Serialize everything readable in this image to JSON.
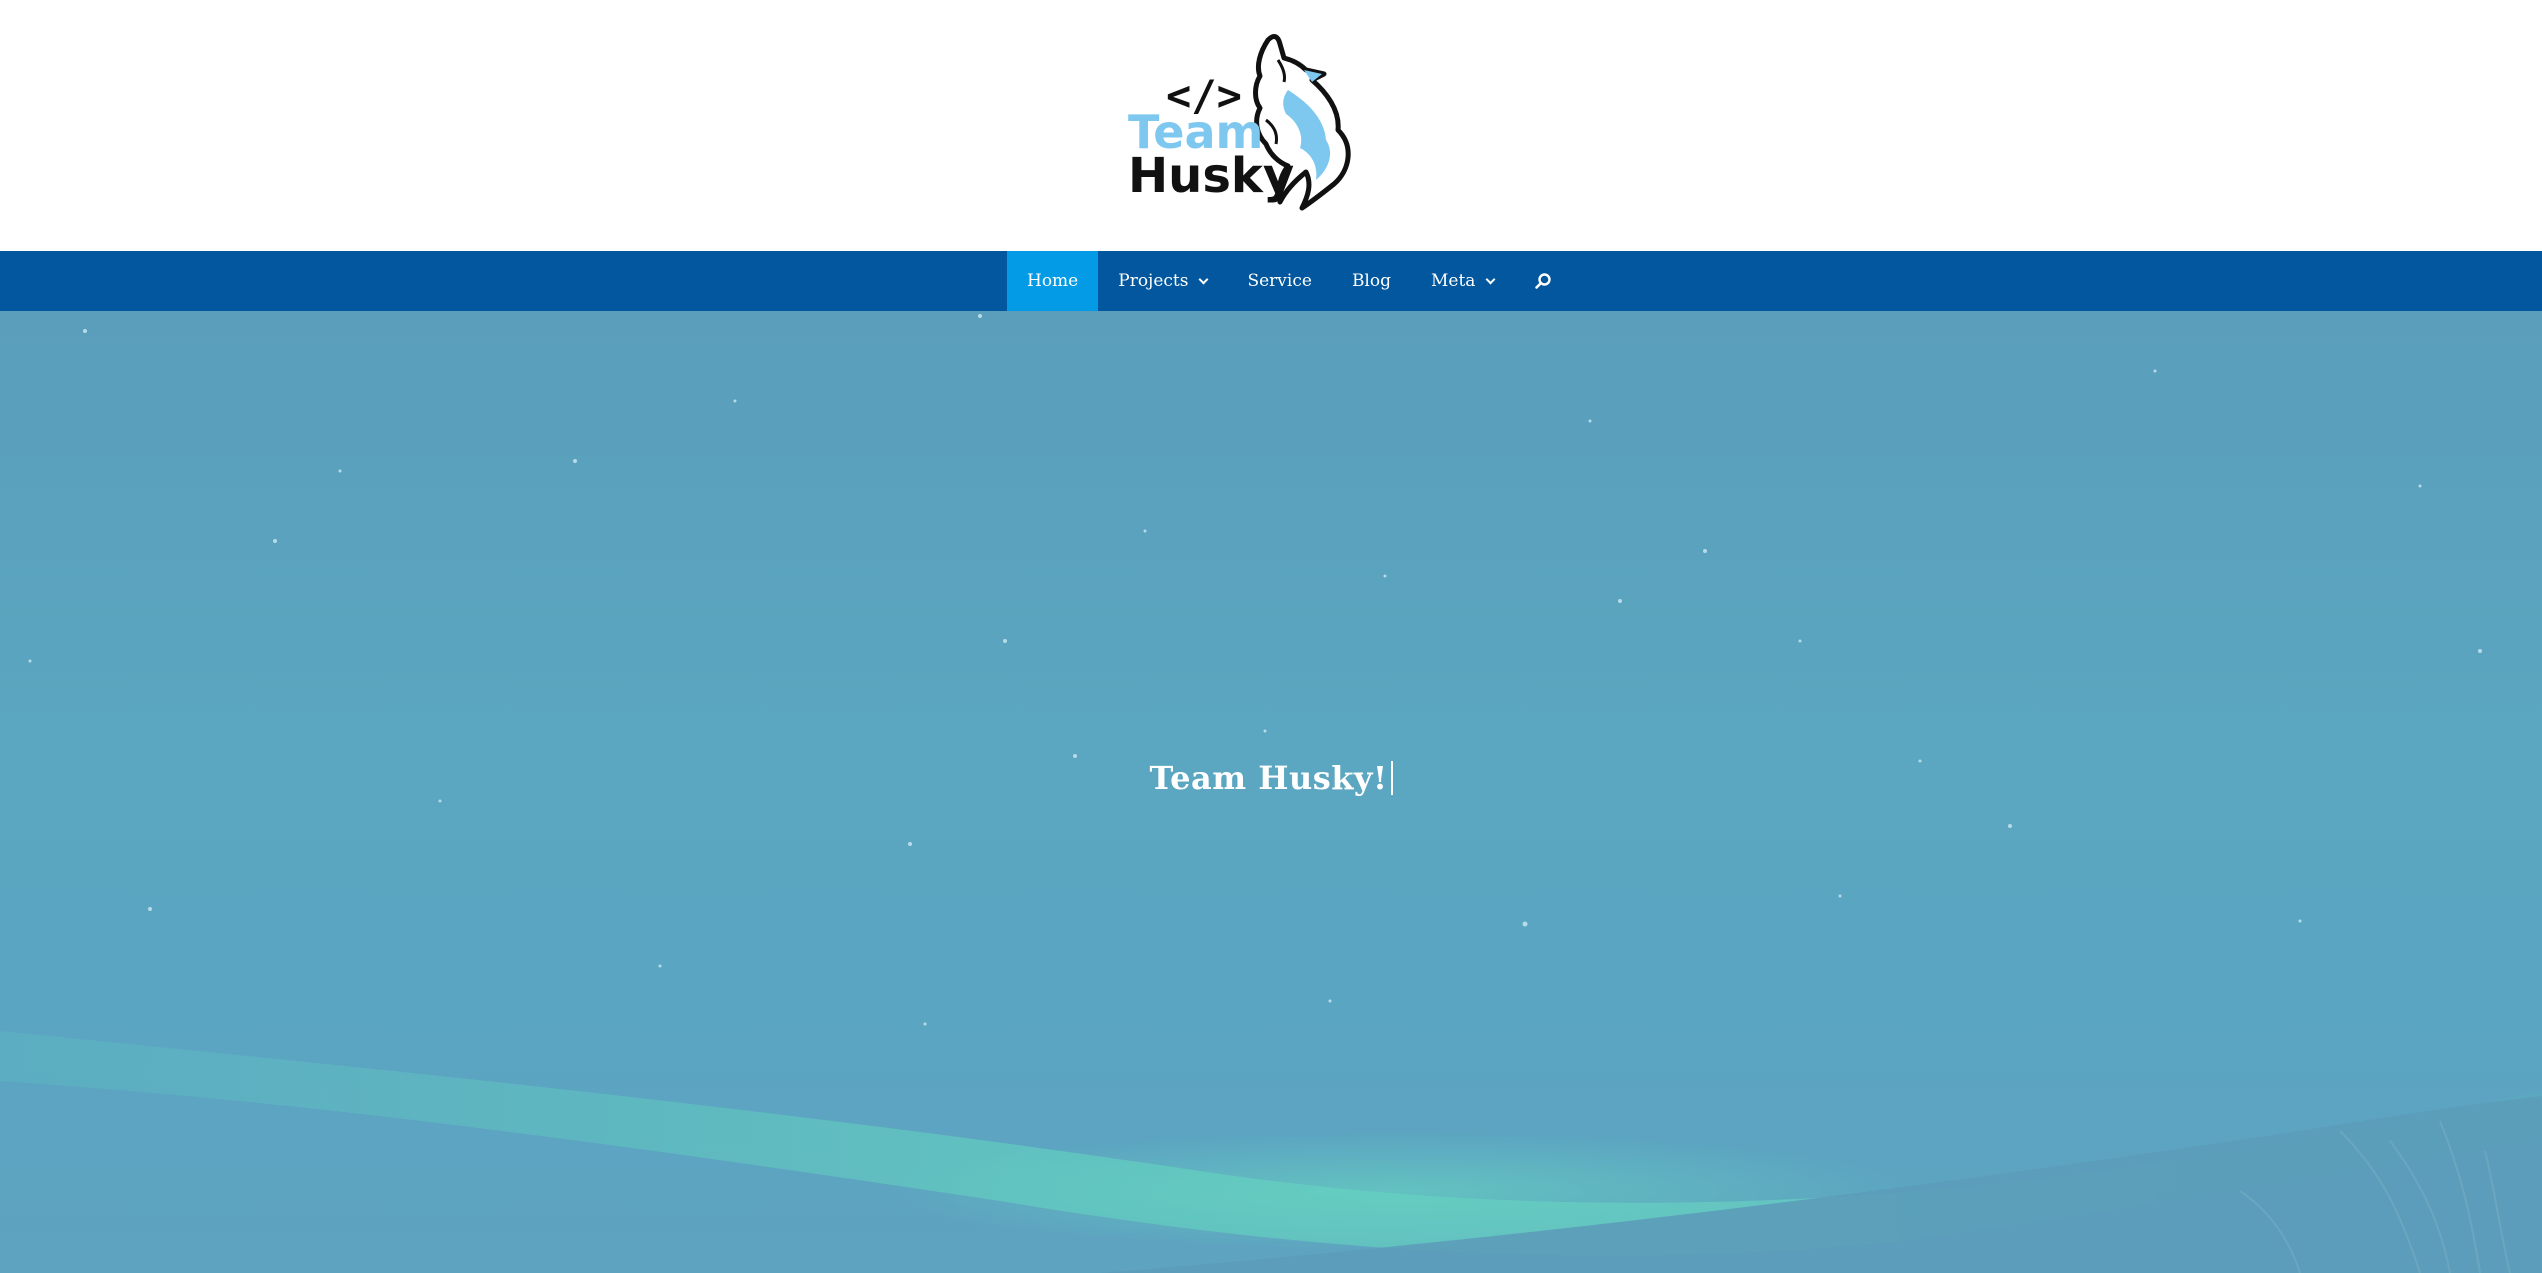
{
  "logo": {
    "code_glyph": "</>",
    "line1": "Team",
    "line2": "Husky",
    "alt": "Team Husky logo (howling husky)"
  },
  "nav": {
    "items": [
      {
        "label": "Home",
        "active": true,
        "has_dropdown": false
      },
      {
        "label": "Projects",
        "active": false,
        "has_dropdown": true
      },
      {
        "label": "Service",
        "active": false,
        "has_dropdown": false
      },
      {
        "label": "Blog",
        "active": false,
        "has_dropdown": false
      },
      {
        "label": "Meta",
        "active": false,
        "has_dropdown": true
      }
    ],
    "search_icon": "search-icon"
  },
  "hero": {
    "title": "Team Husky!"
  },
  "colors": {
    "nav_bg": "#02579e",
    "nav_active": "#039be5",
    "hero_bg": "#5aa3bf",
    "logo_accent": "#7ec8f0"
  }
}
